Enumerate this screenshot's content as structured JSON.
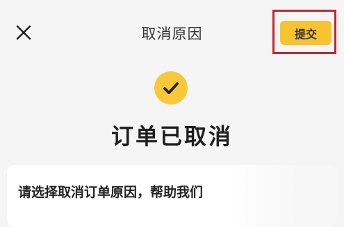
{
  "header": {
    "title": "取消原因",
    "submit_label": "提交"
  },
  "icons": {
    "close": "close-icon",
    "status": "checkmark-icon"
  },
  "status": {
    "title": "订单已取消"
  },
  "reason_card": {
    "prompt": "请选择取消订单原因，帮助我们"
  },
  "colors": {
    "accent": "#f7c331",
    "highlight_border": "#c8242b",
    "background": "#f5f5f5",
    "card": "#ffffff",
    "text": "#1e1e1e"
  }
}
